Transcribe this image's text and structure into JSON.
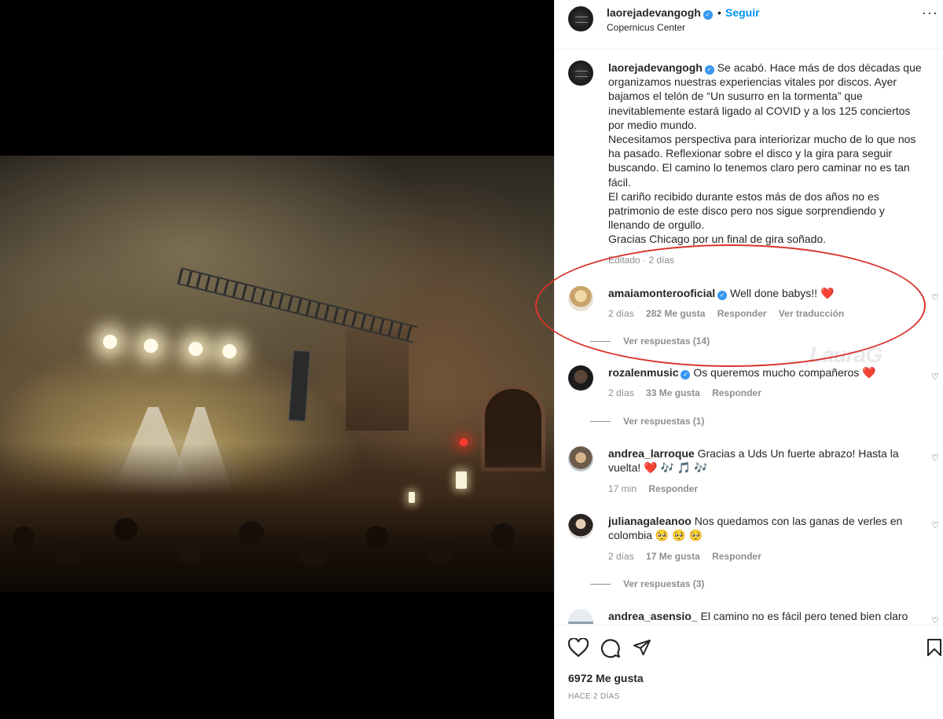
{
  "post": {
    "username": "laorejadevangogh",
    "follow_label": "Seguir",
    "location": "Copernicus Center",
    "caption_paragraphs": [
      "Se acabó. Hace más de dos décadas que organizamos nuestras experiencias vitales por discos. Ayer bajamos el telón de “Un susurro en la tormenta” que inevitablemente estará ligado al COVID y a los 125 conciertos por medio mundo.",
      "Necesitamos perspectiva para interiorizar mucho de lo que nos ha pasado. Reflexionar sobre el disco y la gira para seguir buscando. El camino lo tenemos claro pero caminar no es tan fácil.",
      "El cariño recibido durante estos más de dos años no es patrimonio de este disco pero nos sigue sorprendiendo y llenando de orgullo.",
      "Gracias Chicago por un final de gira soñado."
    ],
    "edited": "Editado · 2 días",
    "likes": "6972 Me gusta",
    "time_ago": "HACE 2 DÍAS"
  },
  "comments": [
    {
      "username": "amaiamonterooficial",
      "text": "Well done babys!! ",
      "emoji": "❤️",
      "time": "2 días",
      "likes": "282 Me gusta",
      "reply": "Responder",
      "translate": "Ver traducción",
      "replies": "Ver respuestas (14)"
    },
    {
      "username": "rozalenmusic",
      "text": "Os queremos mucho compañeros ",
      "emoji": "❤️",
      "time": "2 días",
      "likes": "33 Me gusta",
      "reply": "Responder",
      "replies": "Ver respuestas (1)"
    },
    {
      "username": "andrea_larroque",
      "text": "Gracias a Uds Un fuerte abrazo! Hasta la vuelta! ",
      "emoji": "❤️ 🎶 🎵 🎶",
      "time": "17 min",
      "reply": "Responder"
    },
    {
      "username": "julianagaleanoo",
      "text": "Nos quedamos con las ganas de verles en colombia ",
      "emoji": "🥺 🥺 🥺",
      "time": "2 días",
      "likes": "17 Me gusta",
      "reply": "Responder",
      "replies": "Ver respuestas (3)"
    },
    {
      "username": "andrea_asensio_",
      "text": "El camino no es fácil pero tened bien claro"
    }
  ],
  "watermark": "LauraG",
  "icons": {
    "like": "heart-icon",
    "comment": "comment-icon",
    "share": "share-icon",
    "save": "bookmark-icon",
    "more": "more-icon",
    "verified": "verified-badge-icon"
  },
  "colors": {
    "link_blue": "#0095f6",
    "verified_blue": "#3897f0",
    "annotation_red": "#d9342b",
    "heart_red": "#e0245e"
  }
}
